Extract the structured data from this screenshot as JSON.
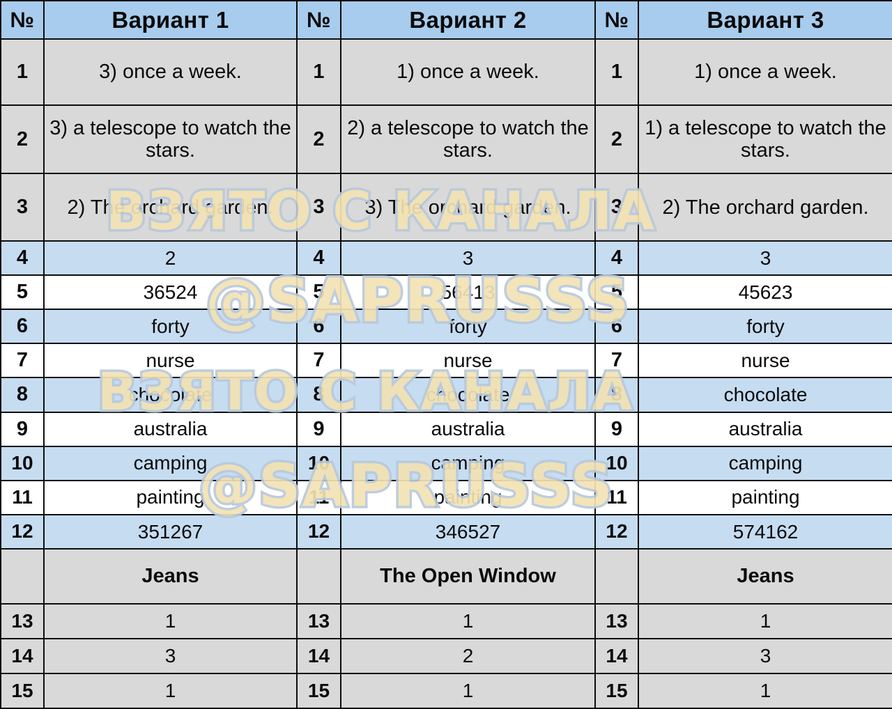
{
  "table": {
    "headers": {
      "num": "№",
      "variant1": "Вариант 1",
      "variant2": "Вариант 2",
      "variant3": "Вариант 3"
    },
    "rows": [
      {
        "n": "1",
        "v1": "3) once a week.",
        "v2": "1) once a week.",
        "v3": "1) once a week.",
        "style": "gray"
      },
      {
        "n": "2",
        "v1": "3) a telescope to watch the stars.",
        "v2": "2) a telescope to watch the stars.",
        "v3": "1) a telescope to watch the stars.",
        "style": "gray"
      },
      {
        "n": "3",
        "v1": "2) The orchard garden.",
        "v2": "3) The orchard garden.",
        "v3": "2) The orchard garden.",
        "style": "gray"
      },
      {
        "n": "4",
        "v1": "2",
        "v2": "3",
        "v3": "3",
        "style": "blue"
      },
      {
        "n": "5",
        "v1": "36524",
        "v2": "56413",
        "v3": "45623",
        "style": "white"
      },
      {
        "n": "6",
        "v1": "forty",
        "v2": "forty",
        "v3": "forty",
        "style": "blue"
      },
      {
        "n": "7",
        "v1": "nurse",
        "v2": "nurse",
        "v3": "nurse",
        "style": "white"
      },
      {
        "n": "8",
        "v1": "chocolate",
        "v2": "chocolate",
        "v3": "chocolate",
        "style": "blue"
      },
      {
        "n": "9",
        "v1": "australia",
        "v2": "australia",
        "v3": "australia",
        "style": "white"
      },
      {
        "n": "10",
        "v1": "camping",
        "v2": "camping",
        "v3": "camping",
        "style": "blue"
      },
      {
        "n": "11",
        "v1": "painting",
        "v2": "painting",
        "v3": "painting",
        "style": "white"
      },
      {
        "n": "12",
        "v1": "351267",
        "v2": "346527",
        "v3": "574162",
        "style": "blue"
      }
    ],
    "text_titles": {
      "num": "",
      "v1": "Jeans",
      "v2": "The Open Window",
      "v3": "Jeans"
    },
    "rows_tail": [
      {
        "n": "13",
        "v1": "1",
        "v2": "1",
        "v3": "1",
        "style": "gray"
      },
      {
        "n": "14",
        "v1": "3",
        "v2": "2",
        "v3": "3",
        "style": "gray"
      },
      {
        "n": "15",
        "v1": "1",
        "v2": "1",
        "v3": "1",
        "style": "gray"
      }
    ]
  },
  "watermark": {
    "line1": "ВЗЯТО С КАНАЛА",
    "line2": "@SAPRUSSS",
    "line3": "ВЗЯТО С КАНАЛА",
    "line4": "@SAPRUSSS"
  },
  "colors": {
    "header_blue": "#a8cced",
    "row_blue": "#c6dcf1",
    "row_gray": "#d9d9d9",
    "row_white": "#ffffff",
    "grid_line": "#0d0d0d",
    "watermark_fill": "#f2e2b4",
    "watermark_stroke": "#b9c9dc"
  }
}
